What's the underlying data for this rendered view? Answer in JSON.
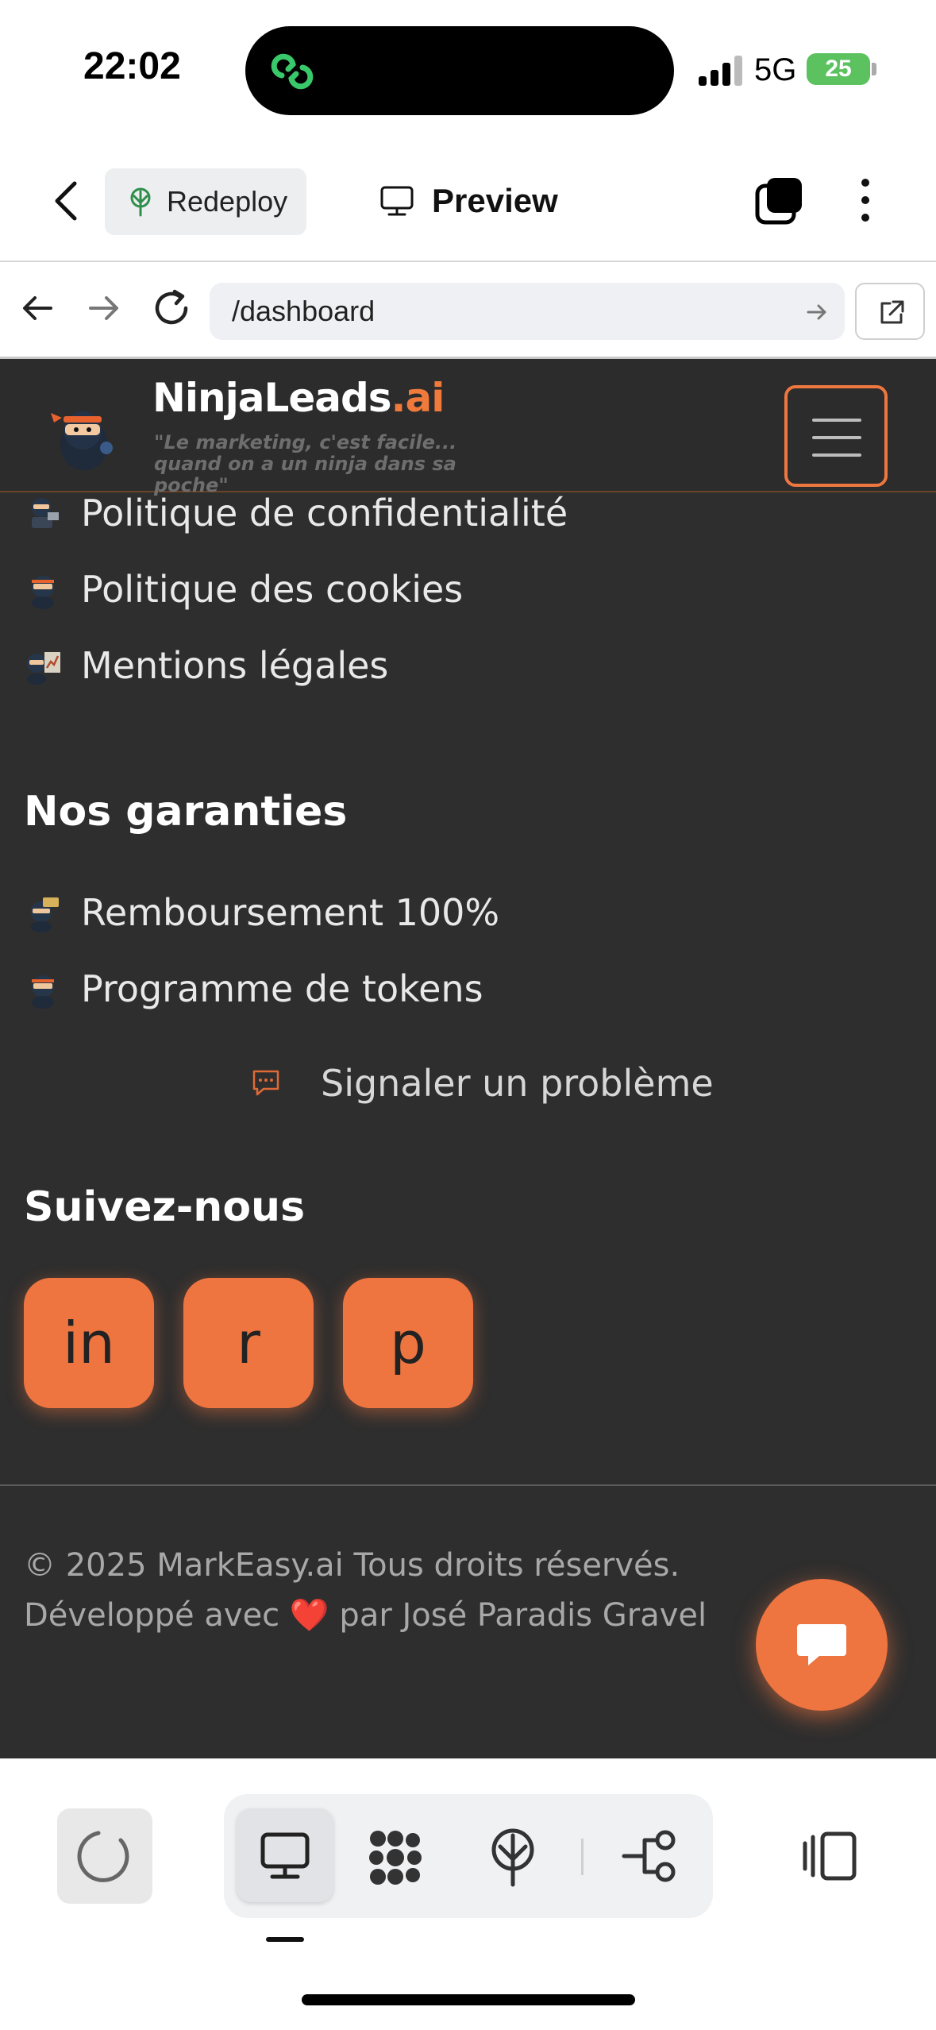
{
  "status_bar": {
    "time": "22:02",
    "network": "5G",
    "battery": "25"
  },
  "toolbar": {
    "redeploy_label": "Redeploy",
    "preview_label": "Preview"
  },
  "browser": {
    "url": "/dashboard"
  },
  "site": {
    "brand_main": "NinjaLeads",
    "brand_suffix": ".ai",
    "tagline": "\"Le marketing, c'est facile... quand on a un ninja dans sa poche\"",
    "accent_color": "#ee7440",
    "legal_links": [
      {
        "label": "Politique de confidentialité",
        "icon": "ninja-laptop-icon"
      },
      {
        "label": "Politique des cookies",
        "icon": "ninja-icon"
      },
      {
        "label": "Mentions légales",
        "icon": "ninja-chart-icon"
      }
    ],
    "guarantees_title": "Nos garanties",
    "guarantees": [
      {
        "label": "Remboursement 100%",
        "icon": "ninja-money-icon"
      },
      {
        "label": "Programme de tokens",
        "icon": "ninja-icon"
      }
    ],
    "report_label": "Signaler un problème",
    "follow_title": "Suivez-nous",
    "social": [
      "in",
      "r",
      "p"
    ],
    "copyright": "© 2025 MarkEasy.ai Tous droits réservés.",
    "credit_prefix": "Développé avec",
    "credit_heart": "❤️",
    "credit_suffix": "par José Paradis Gravel"
  }
}
